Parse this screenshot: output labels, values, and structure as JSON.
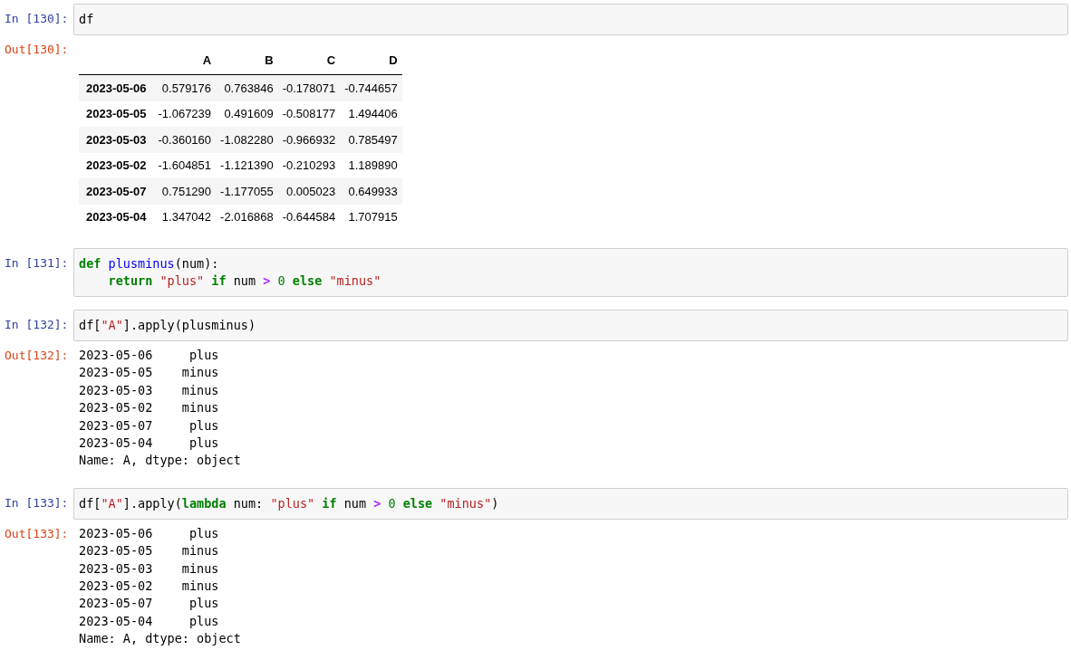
{
  "cells": [
    {
      "input_prompt": "In [130]:",
      "code": [
        [
          {
            "kind": "plain",
            "text": "df"
          }
        ]
      ],
      "output": {
        "prompt": "Out[130]:",
        "kind": "table",
        "columns": [
          "A",
          "B",
          "C",
          "D"
        ],
        "rows": [
          {
            "index": "2023-05-06",
            "values": [
              "0.579176",
              "0.763846",
              "-0.178071",
              "-0.744657"
            ]
          },
          {
            "index": "2023-05-05",
            "values": [
              "-1.067239",
              "0.491609",
              "-0.508177",
              "1.494406"
            ]
          },
          {
            "index": "2023-05-03",
            "values": [
              "-0.360160",
              "-1.082280",
              "-0.966932",
              "0.785497"
            ]
          },
          {
            "index": "2023-05-02",
            "values": [
              "-1.604851",
              "-1.121390",
              "-0.210293",
              "1.189890"
            ]
          },
          {
            "index": "2023-05-07",
            "values": [
              "0.751290",
              "-1.177055",
              "0.005023",
              "0.649933"
            ]
          },
          {
            "index": "2023-05-04",
            "values": [
              "1.347042",
              "-2.016868",
              "-0.644584",
              "1.707915"
            ]
          }
        ]
      }
    },
    {
      "input_prompt": "In [131]:",
      "code": [
        [
          {
            "kind": "keyword",
            "text": "def"
          },
          {
            "kind": "function",
            "text": " plusminus"
          },
          {
            "kind": "plain",
            "text": "(num):"
          }
        ],
        [
          {
            "kind": "keyword",
            "text": "    return"
          },
          {
            "kind": "string",
            "text": " \"plus\""
          },
          {
            "kind": "keyword",
            "text": " if"
          },
          {
            "kind": "plain",
            "text": " num "
          },
          {
            "kind": "operator",
            "text": ">"
          },
          {
            "kind": "number",
            "text": " 0"
          },
          {
            "kind": "keyword",
            "text": " else"
          },
          {
            "kind": "string",
            "text": " \"minus\""
          }
        ]
      ]
    },
    {
      "input_prompt": "In [132]:",
      "code": [
        [
          {
            "kind": "plain",
            "text": "df["
          },
          {
            "kind": "string",
            "text": "\"A\""
          },
          {
            "kind": "plain",
            "text": "].apply(plusminus)"
          }
        ]
      ],
      "output": {
        "prompt": "Out[132]:",
        "kind": "text",
        "lines": [
          "2023-05-06     plus",
          "2023-05-05    minus",
          "2023-05-03    minus",
          "2023-05-02    minus",
          "2023-05-07     plus",
          "2023-05-04     plus",
          "Name: A, dtype: object"
        ]
      }
    },
    {
      "input_prompt": "In [133]:",
      "code": [
        [
          {
            "kind": "plain",
            "text": "df["
          },
          {
            "kind": "string",
            "text": "\"A\""
          },
          {
            "kind": "plain",
            "text": "].apply("
          },
          {
            "kind": "keyword",
            "text": "lambda"
          },
          {
            "kind": "plain",
            "text": " num: "
          },
          {
            "kind": "string",
            "text": "\"plus\""
          },
          {
            "kind": "keyword",
            "text": " if"
          },
          {
            "kind": "plain",
            "text": " num "
          },
          {
            "kind": "operator",
            "text": ">"
          },
          {
            "kind": "number",
            "text": " 0"
          },
          {
            "kind": "keyword",
            "text": " else"
          },
          {
            "kind": "string",
            "text": " \"minus\""
          },
          {
            "kind": "plain",
            "text": ")"
          }
        ]
      ],
      "output": {
        "prompt": "Out[133]:",
        "kind": "text",
        "lines": [
          "2023-05-06     plus",
          "2023-05-05    minus",
          "2023-05-03    minus",
          "2023-05-02    minus",
          "2023-05-07     plus",
          "2023-05-04     plus",
          "Name: A, dtype: object"
        ]
      }
    }
  ]
}
